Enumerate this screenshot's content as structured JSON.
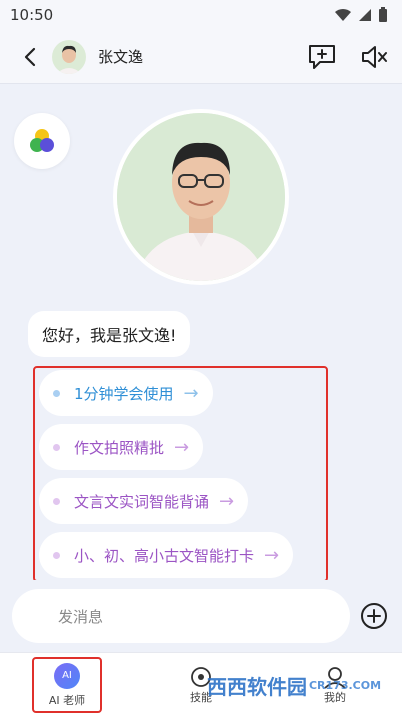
{
  "status_bar": {
    "time": "10:50"
  },
  "header": {
    "name": "张文逸"
  },
  "chat": {
    "greeting": "您好，我是张文逸!",
    "suggestions": [
      {
        "label": "1分钟学会使用",
        "arrow": "→",
        "color": "#2f8fd6",
        "dot": "#a9cff2"
      },
      {
        "label": "作文拍照精批",
        "arrow": "→",
        "color": "#9b54c4",
        "dot": "#e1c6ef"
      },
      {
        "label": "文言文实词智能背诵",
        "arrow": "→",
        "color": "#9b54c4",
        "dot": "#e1c6ef"
      },
      {
        "label": "小、初、高小古文智能打卡",
        "arrow": "→",
        "color": "#9b54c4",
        "dot": "#e1c6ef"
      }
    ]
  },
  "input": {
    "placeholder": "发消息"
  },
  "nav": {
    "ai": {
      "badge": "AI",
      "label": "AI 老师"
    },
    "skill": {
      "label": "技能"
    },
    "me": {
      "label": "我的"
    }
  },
  "watermark": {
    "text": "西西软件园",
    "sub": "CR173.COM"
  }
}
